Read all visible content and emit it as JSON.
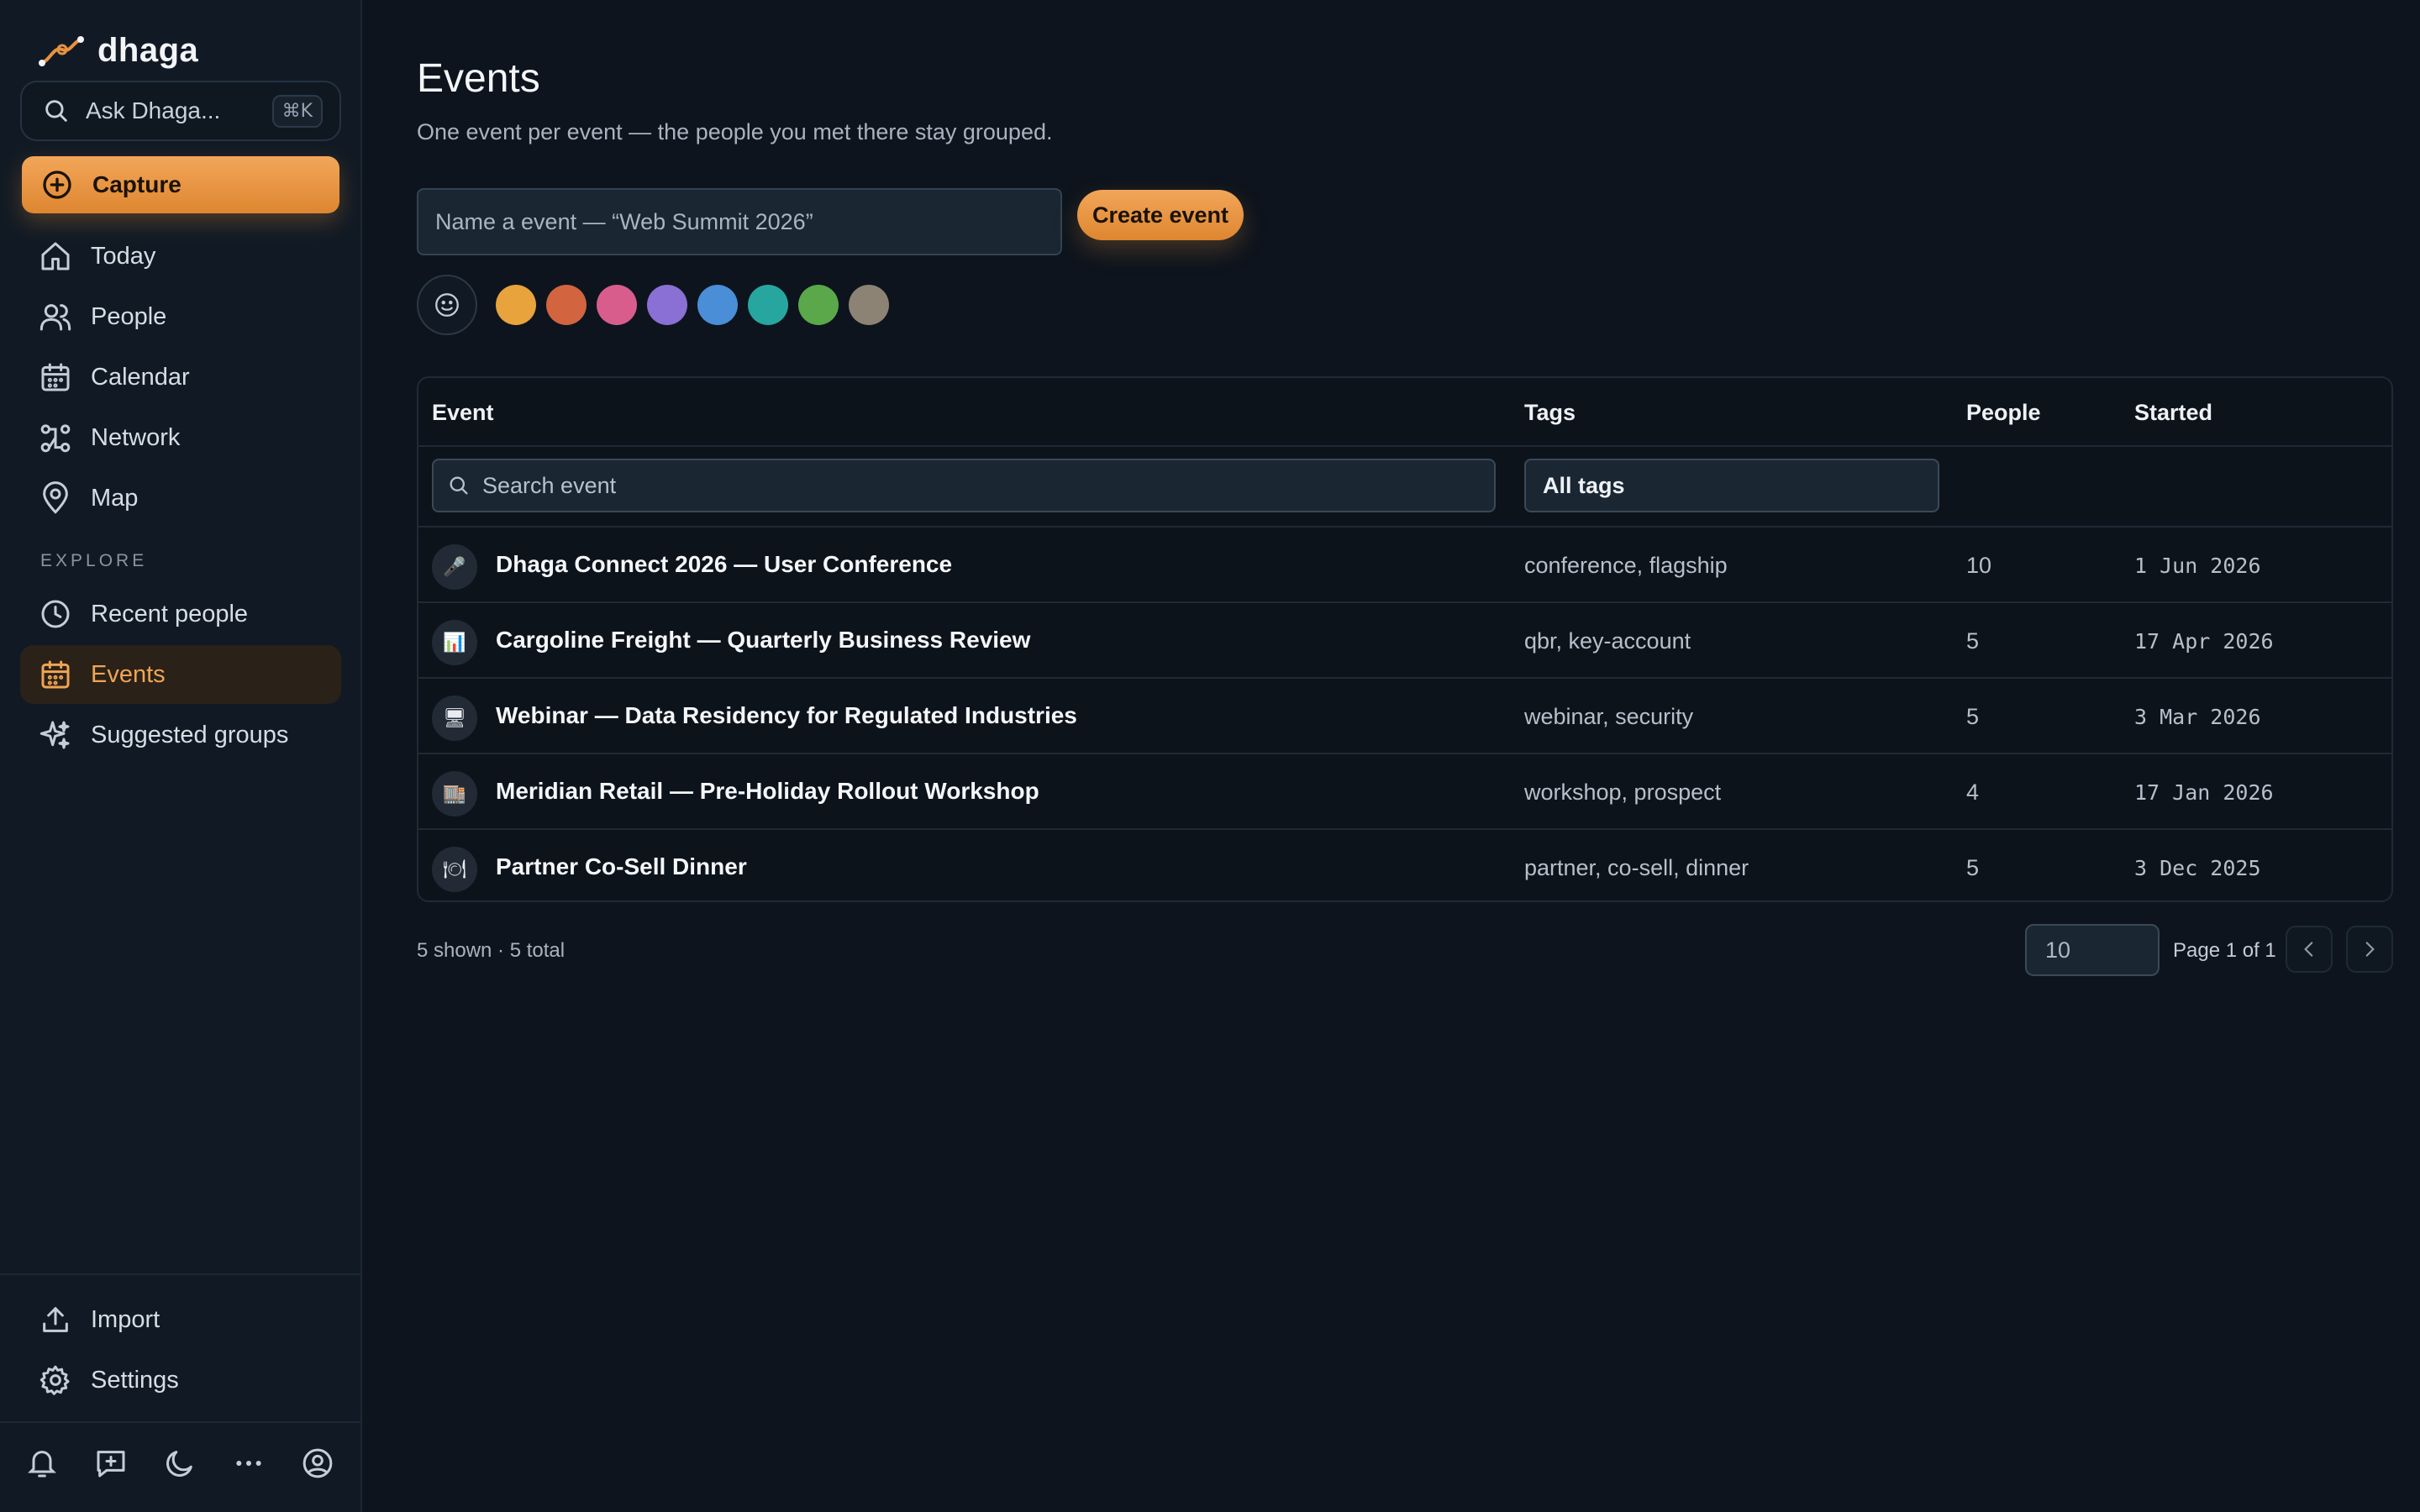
{
  "app": {
    "name": "dhaga",
    "ask_label": "Ask Dhaga...",
    "ask_shortcut": "⌘K",
    "capture_label": "Capture"
  },
  "nav": {
    "primary": [
      {
        "label": "Today",
        "icon": "home-icon"
      },
      {
        "label": "People",
        "icon": "users-icon"
      },
      {
        "label": "Calendar",
        "icon": "calendar-icon"
      },
      {
        "label": "Network",
        "icon": "network-icon"
      },
      {
        "label": "Map",
        "icon": "map-pin-icon"
      }
    ],
    "explore_label": "EXPLORE",
    "explore": [
      {
        "label": "Recent people",
        "icon": "clock-icon"
      },
      {
        "label": "Events",
        "icon": "calendar-icon",
        "active": true
      },
      {
        "label": "Suggested groups",
        "icon": "sparkle-icon"
      }
    ],
    "bottom": [
      {
        "label": "Import",
        "icon": "upload-icon"
      },
      {
        "label": "Settings",
        "icon": "gear-icon"
      }
    ],
    "footer_icons": [
      "bell-icon",
      "message-plus-icon",
      "moon-icon",
      "more-icon",
      "account-icon"
    ]
  },
  "page": {
    "title": "Events",
    "subtitle": "One event per event — the people you met there stay grouped.",
    "name_placeholder": "Name a event — “Web Summit 2026”",
    "create_label": "Create event",
    "swatches": [
      "#e8a33c",
      "#d2643f",
      "#d95d8c",
      "#8a6fd4",
      "#4a8ed8",
      "#27a6a0",
      "#5aa84a",
      "#8c8375"
    ]
  },
  "table": {
    "headers": {
      "event": "Event",
      "tags": "Tags",
      "people": "People",
      "started": "Started"
    },
    "search_placeholder": "Search event",
    "tags_filter": "All tags",
    "rows": [
      {
        "icon": "🎤",
        "name": "Dhaga Connect 2026 — User Conference",
        "tags": "conference, flagship",
        "people": "10",
        "started": "1 Jun 2026"
      },
      {
        "icon": "📊",
        "name": "Cargoline Freight — Quarterly Business Review",
        "tags": "qbr, key-account",
        "people": "5",
        "started": "17 Apr 2026"
      },
      {
        "icon": "🖥",
        "name": "Webinar — Data Residency for Regulated Industries",
        "tags": "webinar, security",
        "people": "5",
        "started": "3 Mar 2026"
      },
      {
        "icon": "🏬",
        "name": "Meridian Retail — Pre-Holiday Rollout Workshop",
        "tags": "workshop, prospect",
        "people": "4",
        "started": "17 Jan 2026"
      },
      {
        "icon": "🍽",
        "name": "Partner Co-Sell Dinner",
        "tags": "partner, co-sell, dinner",
        "people": "5",
        "started": "3 Dec 2025"
      }
    ]
  },
  "pagination": {
    "count_text": "5 shown · 5 total",
    "page_size": "10",
    "page_text": "Page 1 of 1"
  },
  "colors": {
    "accent": "#e8923f",
    "background": "#0d141d",
    "sidebar": "#111a24"
  }
}
